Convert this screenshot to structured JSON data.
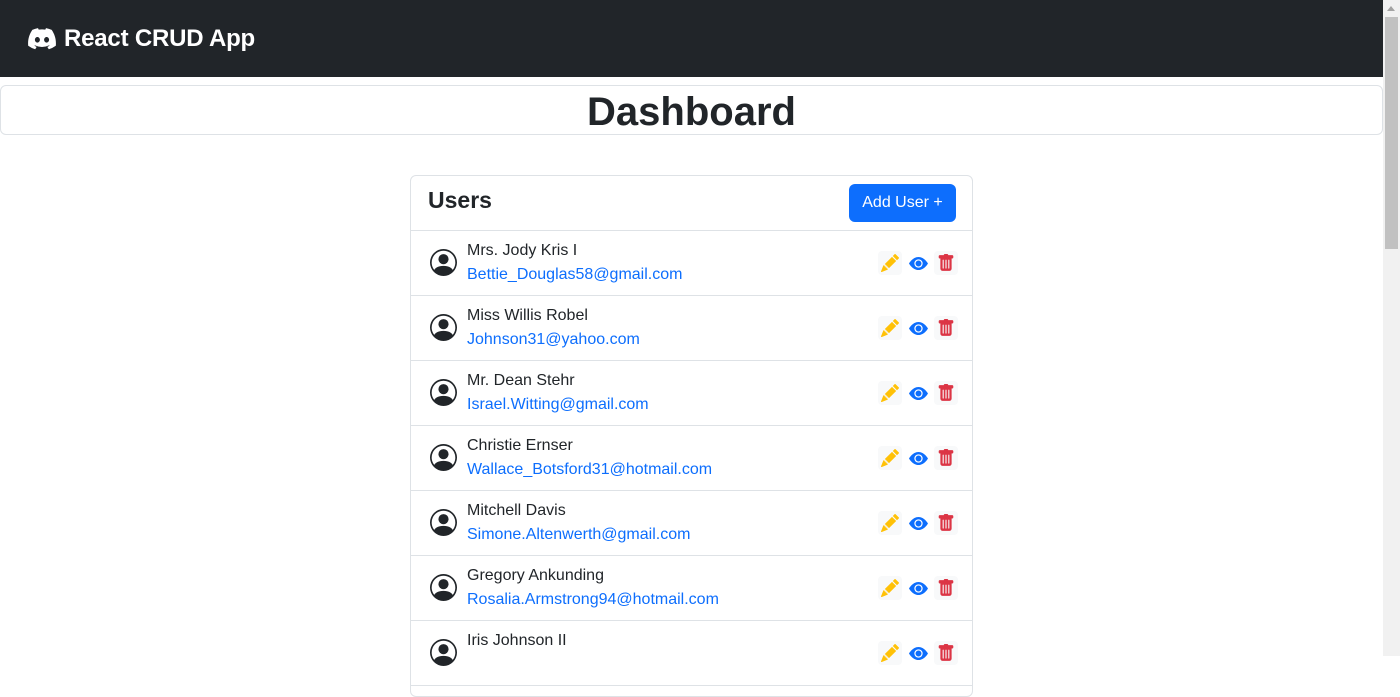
{
  "navbar": {
    "brand": "React CRUD App",
    "brand_icon": "discord-icon",
    "bg": "#212529"
  },
  "page": {
    "title": "Dashboard"
  },
  "users_card": {
    "title": "Users",
    "add_button": "Add User +"
  },
  "users": [
    {
      "name": "Mrs. Jody Kris I",
      "email": "Bettie_Douglas58@gmail.com"
    },
    {
      "name": "Miss Willis Robel",
      "email": "Johnson31@yahoo.com"
    },
    {
      "name": "Mr. Dean Stehr",
      "email": "Israel.Witting@gmail.com"
    },
    {
      "name": "Christie Ernser",
      "email": "Wallace_Botsford31@hotmail.com"
    },
    {
      "name": "Mitchell Davis",
      "email": "Simone.Altenwerth@gmail.com"
    },
    {
      "name": "Gregory Ankunding",
      "email": "Rosalia.Armstrong94@hotmail.com"
    },
    {
      "name": "Iris Johnson II",
      "email": ""
    }
  ],
  "row_actions": {
    "edit_icon": "pencil-icon",
    "view_icon": "eye-icon",
    "delete_icon": "trash-icon"
  },
  "colors": {
    "primary": "#0d6efd",
    "warning": "#ffc107",
    "danger": "#dc3545",
    "dark": "#212529"
  }
}
